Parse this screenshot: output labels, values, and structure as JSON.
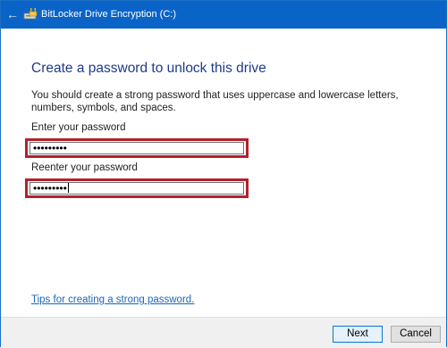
{
  "window": {
    "title": "BitLocker Drive Encryption (C:)",
    "back_icon": "back-arrow-icon",
    "app_icon": "bitlocker-drive-icon",
    "accent_color": "#0a64c8"
  },
  "main": {
    "heading": "Create a password to unlock this drive",
    "description": "You should create a strong password that uses uppercase and lowercase letters, numbers, symbols, and spaces.",
    "password_label": "Enter your password",
    "password_value": "•••••••••",
    "reenter_label": "Reenter your password",
    "reenter_value": "•••••••••",
    "highlight_color": "#b3212b",
    "tips_link": "Tips for creating a strong password."
  },
  "footer": {
    "next_label": "Next",
    "cancel_label": "Cancel"
  }
}
